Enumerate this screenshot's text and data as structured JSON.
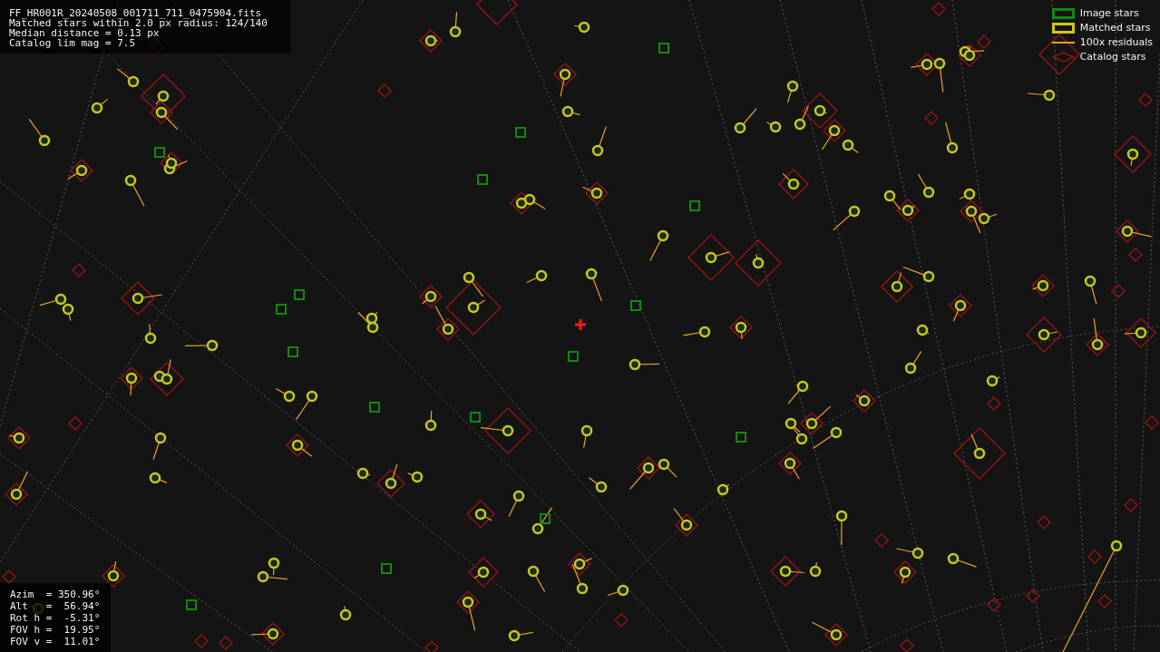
{
  "header": {
    "lines": [
      "FF_HR001R_20240508_001711_711_0475904.fits",
      "Matched stars within 2.0 px radius: 124/140",
      "Median distance = 0.13 px",
      "Catalog lim mag = 7.5"
    ]
  },
  "legend": {
    "items": [
      {
        "label": "Image stars",
        "kind": "box",
        "color": "#0e8a0e"
      },
      {
        "label": "Matched stars",
        "kind": "box",
        "color": "#c8c81e"
      },
      {
        "label": "100x residuals",
        "kind": "line",
        "color": "#f0a028"
      },
      {
        "label": "Catalog stars",
        "kind": "diamond",
        "color": "#8c1414"
      }
    ]
  },
  "readout": {
    "lines": [
      "Azim  = 350.96°",
      "Alt   =  56.94°",
      "Rot h =  -5.31°",
      "FOV h =  19.95°",
      "FOV v =  11.01°"
    ]
  }
}
